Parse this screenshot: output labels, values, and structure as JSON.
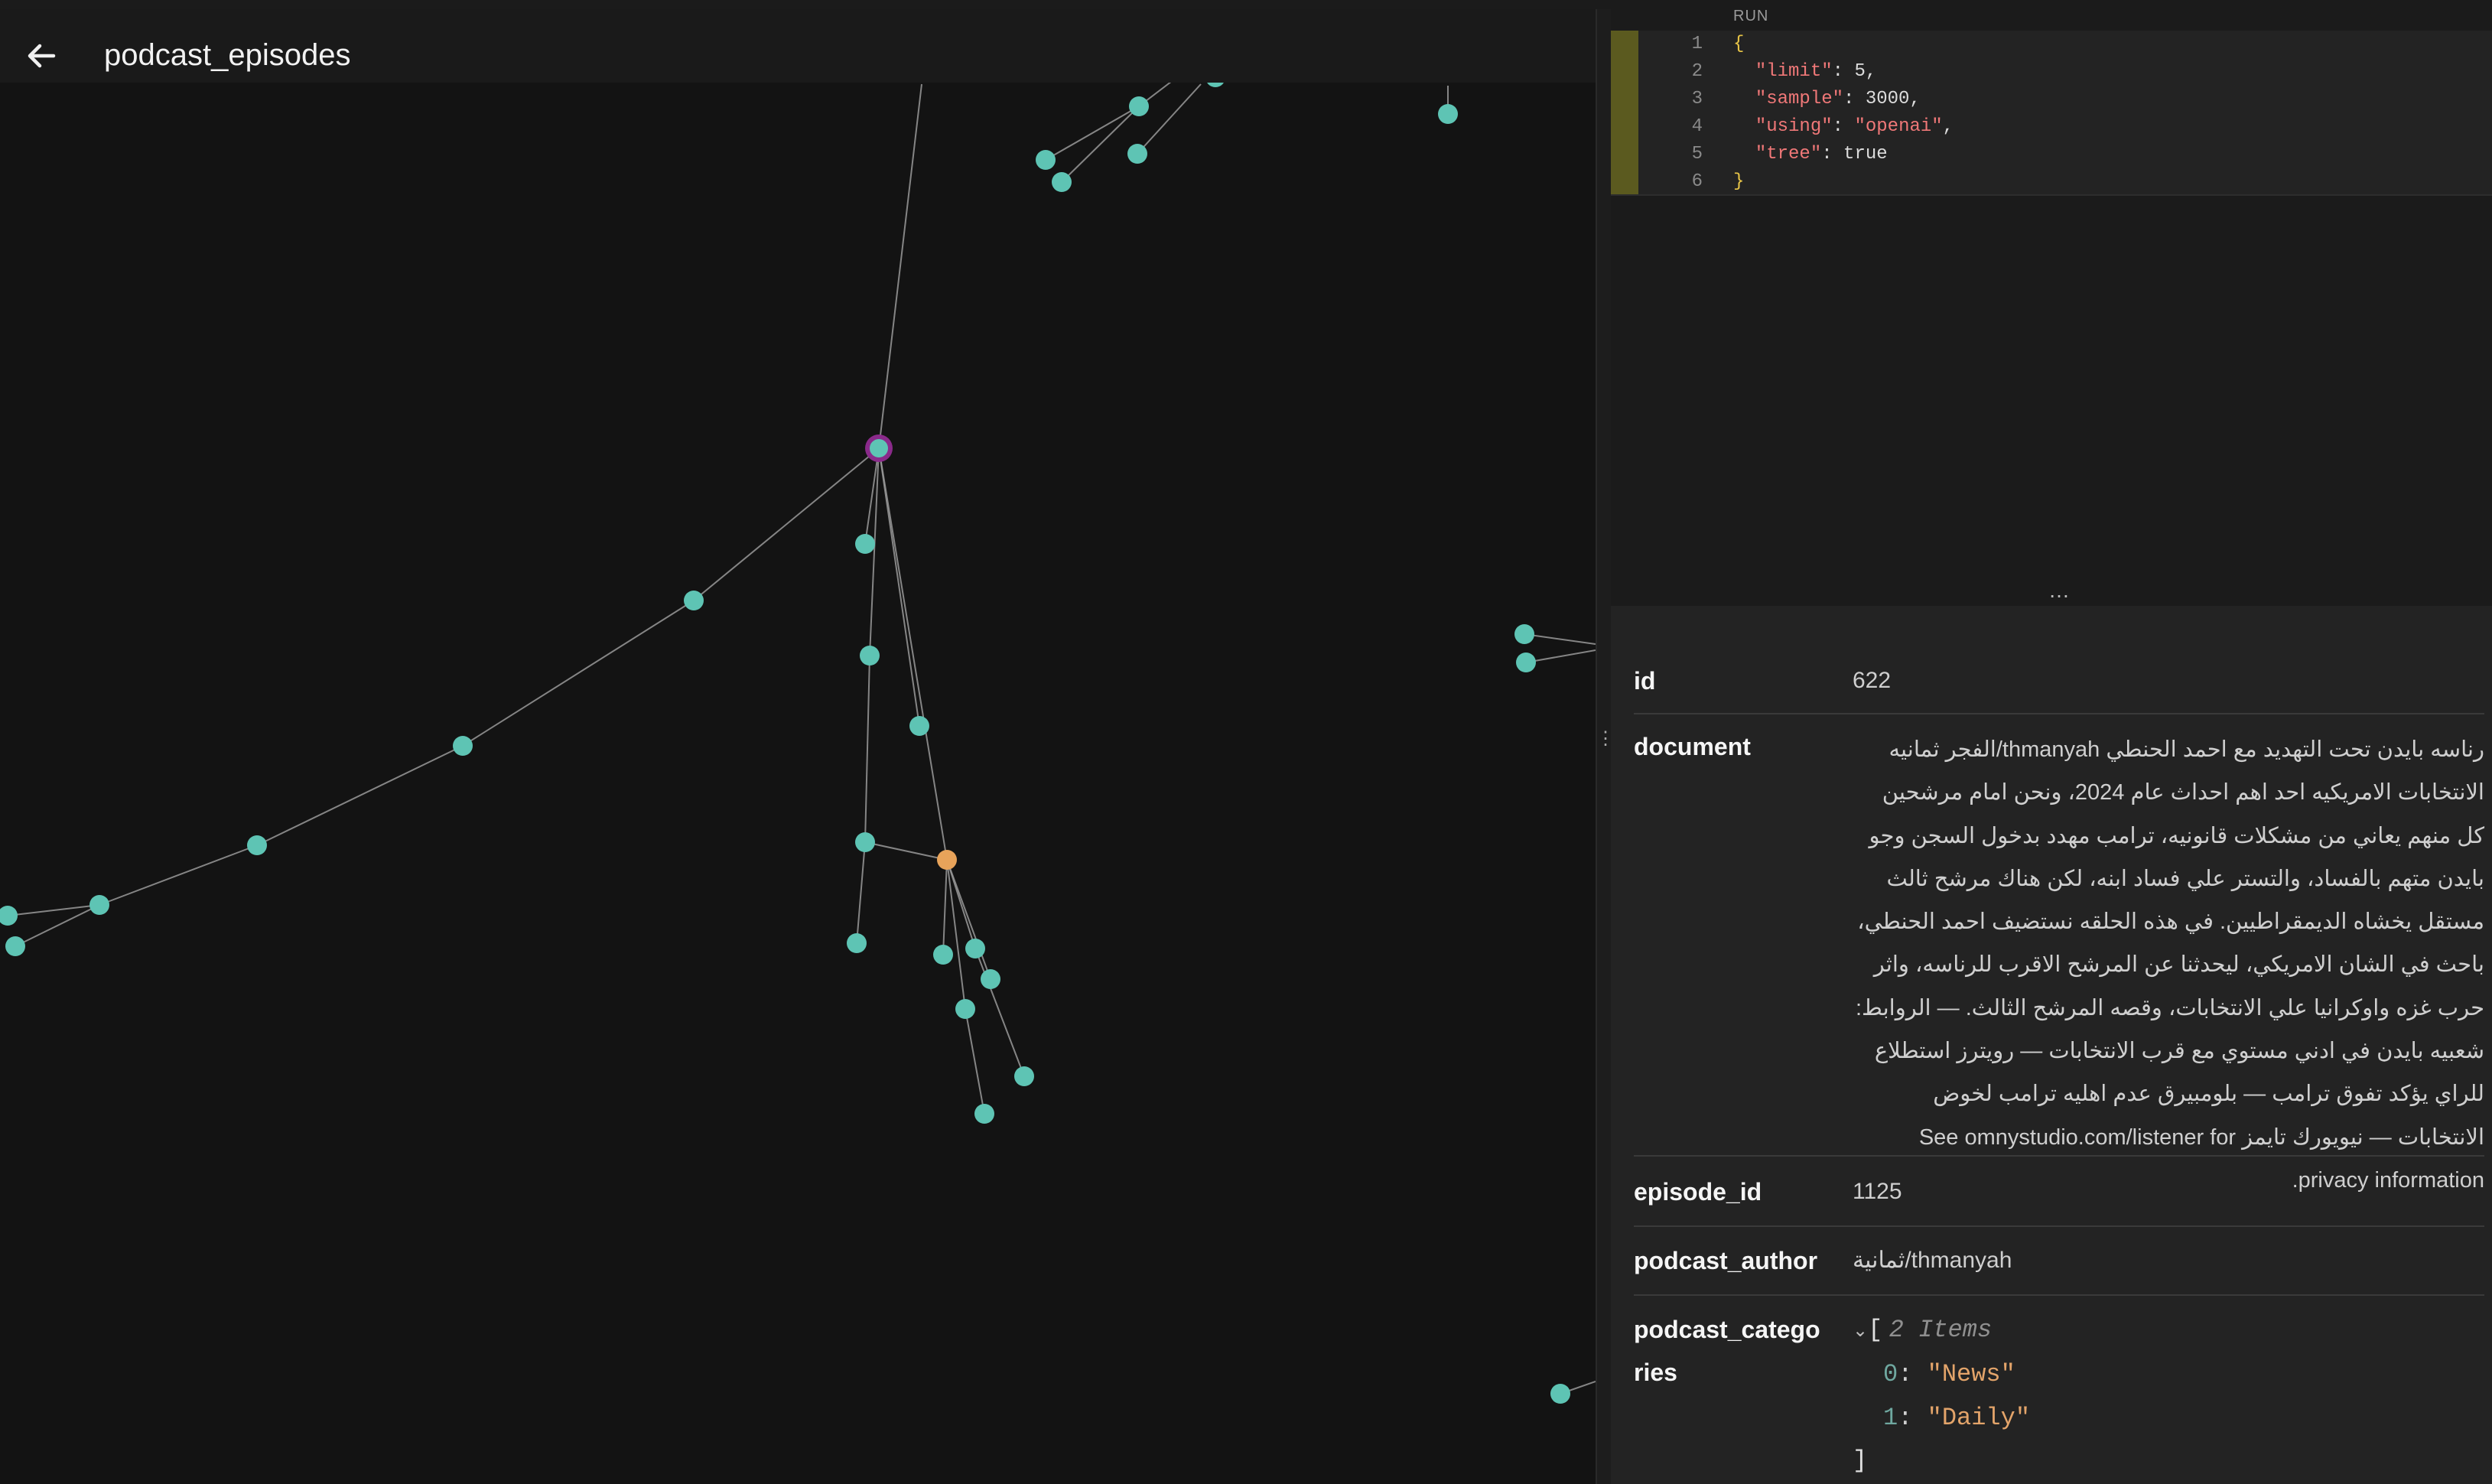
{
  "header": {
    "title": "podcast_episodes",
    "back_icon": "arrow-left-icon"
  },
  "editor": {
    "run_label": "RUN",
    "lines": [
      {
        "n": "1",
        "parts": [
          {
            "t": "{",
            "c": "brace"
          }
        ]
      },
      {
        "n": "2",
        "parts": [
          {
            "t": "  ",
            "c": "plain"
          },
          {
            "t": "\"limit\"",
            "c": "key"
          },
          {
            "t": ": 5,",
            "c": "plain"
          }
        ]
      },
      {
        "n": "3",
        "parts": [
          {
            "t": "  ",
            "c": "plain"
          },
          {
            "t": "\"sample\"",
            "c": "key"
          },
          {
            "t": ": 3000,",
            "c": "plain"
          }
        ]
      },
      {
        "n": "4",
        "parts": [
          {
            "t": "  ",
            "c": "plain"
          },
          {
            "t": "\"using\"",
            "c": "key"
          },
          {
            "t": ": ",
            "c": "plain"
          },
          {
            "t": "\"openai\"",
            "c": "key"
          },
          {
            "t": ",",
            "c": "plain"
          }
        ]
      },
      {
        "n": "5",
        "parts": [
          {
            "t": "  ",
            "c": "plain"
          },
          {
            "t": "\"tree\"",
            "c": "key"
          },
          {
            "t": ": true",
            "c": "plain"
          }
        ]
      },
      {
        "n": "6",
        "parts": [
          {
            "t": "}",
            "c": "brace"
          }
        ]
      }
    ]
  },
  "details": {
    "id": {
      "key": "id",
      "value": "622"
    },
    "document": {
      "key": "document",
      "value": "رناسه بايدن تحت التهديد مع احمد الحنطي thmanyah/الفجر ثمانيه الانتخابات الامريكيه احد اهم احداث عام 2024، ونحن امام مرشحين كل منهم يعاني من مشكلات قانونيه، ترامب مهدد بدخول السجن وجو بايدن متهم بالفساد، والتستر علي فساد ابنه، لكن هناك مرشح ثالث مستقل يخشاه الديمقراطيين. في هذه الحلقه نستضيف احمد الحنطي، باحث في الشان الامريكي، ليحدثنا عن المرشح الاقرب للرناسه، واثر حرب غزه واوكرانيا علي الانتخابات، وقصه المرشح الثالث. — الروابط: شعبيه بايدن في ادني مستوي مع قرب الانتخابات — رويترز استطلاع للراي يؤكد تفوق ترامب — بلومبيرق عدم اهليه ترامب لخوض الانتخابات — نيويورك تايمز See omnystudio.com/listener for privacy information."
    },
    "episode_id": {
      "key": "episode_id",
      "value": "1125"
    },
    "podcast_author": {
      "key": "podcast_author",
      "value": "ثمانية/thmanyah"
    },
    "podcast_categories": {
      "key_line1": "podcast_catego",
      "key_line2": "ries",
      "open_bracket": "[",
      "count_label": "2 Items",
      "items": [
        {
          "index": "0",
          "value": "\"News\""
        },
        {
          "index": "1",
          "value": "\"Daily\""
        }
      ],
      "close_bracket": "]"
    }
  },
  "graph": {
    "node_color": "#5ec4b4",
    "selected_node_color": "#5ec4b4",
    "selected_ring_color": "#8a2a8a",
    "highlight_node_color": "#e8a35a",
    "edge_color": "#9a9a9a"
  }
}
